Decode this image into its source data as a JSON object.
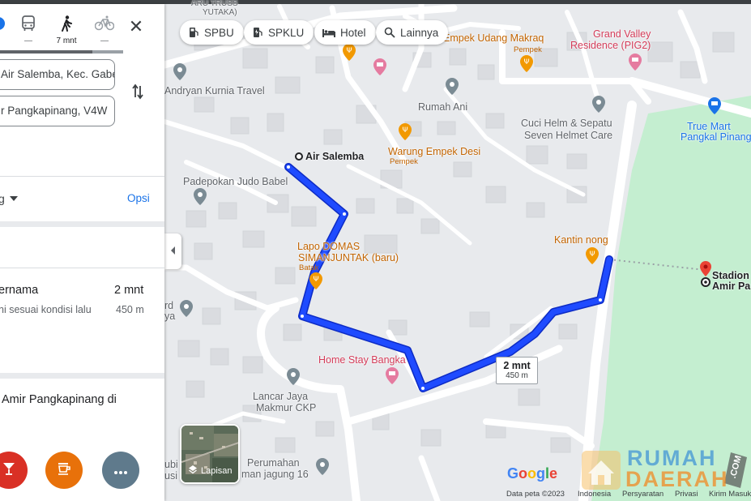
{
  "modes": {
    "walk_time": "7 mnt",
    "transit_placeholder": "—",
    "bike_placeholder": "—"
  },
  "inputs": {
    "origin_value": "Air Salemba, Kec. Gabek",
    "destination_value": "r Pangkapinang, V4W"
  },
  "options_row": {
    "left_label": "g",
    "options_label": "Opsi"
  },
  "route": {
    "name": "ernama",
    "time": "2 mnt",
    "note": "ni sesuai kondisi lalu",
    "distance": "450 m"
  },
  "destination_text": "Amir Pangkapinang di",
  "chips": [
    {
      "label": "SPBU",
      "icon": "gas-station-icon"
    },
    {
      "label": "SPKLU",
      "icon": "ev-charger-icon"
    },
    {
      "label": "Hotel",
      "icon": "bed-icon"
    },
    {
      "label": "Lainnya",
      "icon": "search-icon"
    }
  ],
  "layers_label": "Lapisan",
  "route_bubble": {
    "time": "2 mnt",
    "distance": "450 m"
  },
  "map_labels": {
    "aru_truss": "ARU TRUSS",
    "yutaka": "YUTAKA)",
    "empek_udang": "Empek Udang Makraq",
    "grand_valley_1": "Grand Valley",
    "grand_valley_2": "Residence (PIG2)",
    "pempek_1": "Pempek",
    "andryan": "Andryan Kurnia Travel",
    "rumah_ani": "Rumah Ani",
    "cuci_helm_1": "Cuci Helm & Sepatu",
    "cuci_helm_2": "Seven Helmet Care",
    "true_mart_1": "True Mart",
    "true_mart_2": "Pangkal Pinang",
    "air_salemba": "Air Salemba",
    "warung_empek": "Warung Empek Desi",
    "pempek_2": "Pempek",
    "padepokan": "Padepokan Judo Babel",
    "lapo_1": "Lapo DOMAS",
    "lapo_2": "SIMANJUNTAK (baru)",
    "batak": "Batak",
    "kantin": "Kantin nong",
    "stadion_1": "Stadion",
    "stadion_2": "Amir Pa",
    "rd": "rd",
    "ya": "ya",
    "home_stay": "Home Stay Bangka",
    "lancar_1": "Lancar Jaya",
    "lancar_2": "Makmur CKP",
    "perumahan_1": "Perumahan",
    "perumahan_2": "man jagung 16",
    "ubi_1": "ubi",
    "ubi_2": "usi"
  },
  "footer": {
    "google": "Google",
    "data_peta": "Data peta ©2023",
    "indonesia": "Indonesia",
    "persyaratan": "Persyaratan",
    "privasi": "Privasi",
    "kirim": "Kirim Masuk"
  },
  "watermark": {
    "text_1": "RUMAH",
    "text_2": "DAERAH",
    "suffix": ".COM"
  },
  "colors": {
    "route_blue": "#1a3ee8",
    "accent_blue": "#1a73e8",
    "park_green": "#c4eed0",
    "food_orange": "#f29900",
    "hotel_pink": "#e57ba0",
    "pin_gray": "#7b8b94",
    "dest_red": "#ea4335"
  }
}
